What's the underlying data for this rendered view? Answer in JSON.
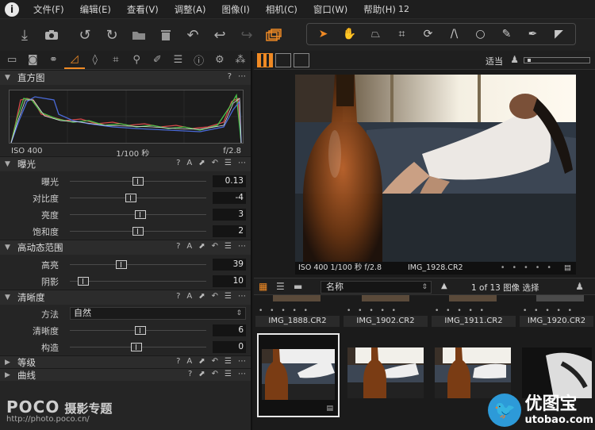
{
  "menu": {
    "logo": "i",
    "items": [
      "文件(F)",
      "编辑(E)",
      "查看(V)",
      "调整(A)",
      "图像(I)",
      "相机(C)",
      "窗口(W)",
      "帮助(H)"
    ],
    "count": "12"
  },
  "histogram": {
    "title": "直方图",
    "iso": "ISO 400",
    "shutter": "1/100 秒",
    "aperture": "f/2.8"
  },
  "exposure": {
    "title": "曝光",
    "rows": [
      {
        "label": "曝光",
        "value": "0.13",
        "level": 0.5
      },
      {
        "label": "对比度",
        "value": "-4",
        "level": 0.45
      },
      {
        "label": "亮度",
        "value": "3",
        "level": 0.52
      },
      {
        "label": "饱和度",
        "value": "2",
        "level": 0.5
      }
    ]
  },
  "hdr": {
    "title": "高动态范围",
    "rows": [
      {
        "label": "高亮",
        "value": "39",
        "level": 0.38
      },
      {
        "label": "阴影",
        "value": "10",
        "level": 0.1
      }
    ]
  },
  "clarity": {
    "title": "清晰度",
    "method_label": "方法",
    "method_value": "自然",
    "rows": [
      {
        "label": "清晰度",
        "value": "6",
        "level": 0.52
      },
      {
        "label": "构造",
        "value": "0",
        "level": 0.49
      }
    ]
  },
  "levels": {
    "title": "等级"
  },
  "curves": {
    "title": "曲线"
  },
  "watermark_left": {
    "logo": "POCO",
    "sub": "摄影专题",
    "url": "http://photo.poco.cn/"
  },
  "viewer": {
    "fit_label": "适当",
    "meta": "ISO 400 1/100 秒 f/2.8",
    "filename": "IMG_1928.CR2",
    "dots": "• • • • •"
  },
  "browser": {
    "sort": "名称",
    "count": "1 of 13 图像  选择",
    "captions": [
      "IMG_1888.CR2",
      "IMG_1902.CR2",
      "IMG_1911.CR2",
      "IMG_1920.CR2"
    ],
    "dots": "• • • • •"
  },
  "watermark_right": {
    "main": "优图宝",
    "url": "utobao.com"
  }
}
